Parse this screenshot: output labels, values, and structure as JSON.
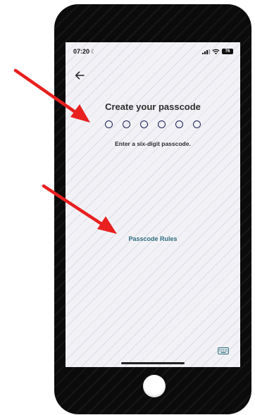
{
  "status_bar": {
    "time": "07:20",
    "battery": "76"
  },
  "passcode": {
    "title": "Create your passcode",
    "digit_count": 6,
    "instruction": "Enter a six-digit passcode.",
    "rules_link": "Passcode Rules"
  },
  "icons": {
    "back": "arrow-left-icon",
    "keyboard": "keyboard-icon",
    "wifi": "wifi-icon",
    "signal": "cellular-signal-icon",
    "moon": "moon-icon"
  },
  "colors": {
    "dot_border": "#1c1f5a",
    "link": "#2f6d7f",
    "annotation_arrow": "#e8201f"
  }
}
